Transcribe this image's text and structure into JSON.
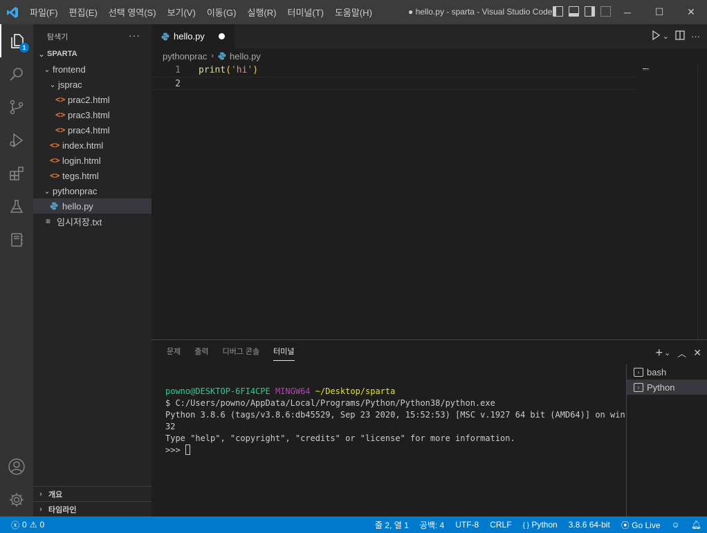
{
  "titlebar": {
    "menu": [
      "파일(F)",
      "편집(E)",
      "선택 영역(S)",
      "보기(V)",
      "이동(G)",
      "실행(R)",
      "터미널(T)",
      "도움말(H)"
    ],
    "title": "● hello.py - sparta - Visual Studio Code",
    "minimize": "─",
    "maximize": "☐",
    "close": "✕"
  },
  "activity_bar": {
    "explorer_badge": "1"
  },
  "sidebar": {
    "title": "탐색기",
    "more": "···",
    "root": "SPARTA",
    "items": [
      {
        "label": "frontend"
      },
      {
        "label": "jsprac"
      },
      {
        "label": "prac2.html"
      },
      {
        "label": "prac3.html"
      },
      {
        "label": "prac4.html"
      },
      {
        "label": "index.html"
      },
      {
        "label": "login.html"
      },
      {
        "label": "tegs.html"
      },
      {
        "label": "pythonprac"
      },
      {
        "label": "hello.py"
      },
      {
        "label": "임시저장.txt"
      }
    ],
    "outline": "개요",
    "timeline": "타임라인"
  },
  "editor": {
    "tab_label": "hello.py",
    "breadcrumb": [
      "pythonprac",
      "hello.py"
    ],
    "lines": [
      {
        "num": "1",
        "fn": "print",
        "open": "(",
        "str": "'hi'",
        "close": ")"
      },
      {
        "num": "2"
      }
    ]
  },
  "panel": {
    "tabs": [
      "문제",
      "출력",
      "디버그 콘솔",
      "터미널"
    ],
    "active_tab": "터미널",
    "terminal": {
      "user": "powno@DESKTOP-6FI4CPE",
      "host": "MINGW64",
      "path": "~/Desktop/sparta",
      "cmd": "$ C:/Users/powno/AppData/Local/Programs/Python/Python38/python.exe",
      "out1": "Python 3.8.6 (tags/v3.8.6:db45529, Sep 23 2020, 15:52:53) [MSC v.1927 64 bit (AMD64)] on win",
      "out2": "32",
      "out3": "Type \"help\", \"copyright\", \"credits\" or \"license\" for more information.",
      "prompt": ">>> "
    },
    "terminals": [
      "bash",
      "Python"
    ]
  },
  "statusbar": {
    "errors": "0",
    "warnings": "0",
    "position": "줄 2, 열 1",
    "spaces": "공백: 4",
    "encoding": "UTF-8",
    "eol": "CRLF",
    "language": "Python",
    "interpreter": "3.8.6 64-bit",
    "golive": "Go Live"
  },
  "colors": {
    "accent": "#007acc",
    "html_icon": "#e37933",
    "python_icon": "#519aba"
  }
}
